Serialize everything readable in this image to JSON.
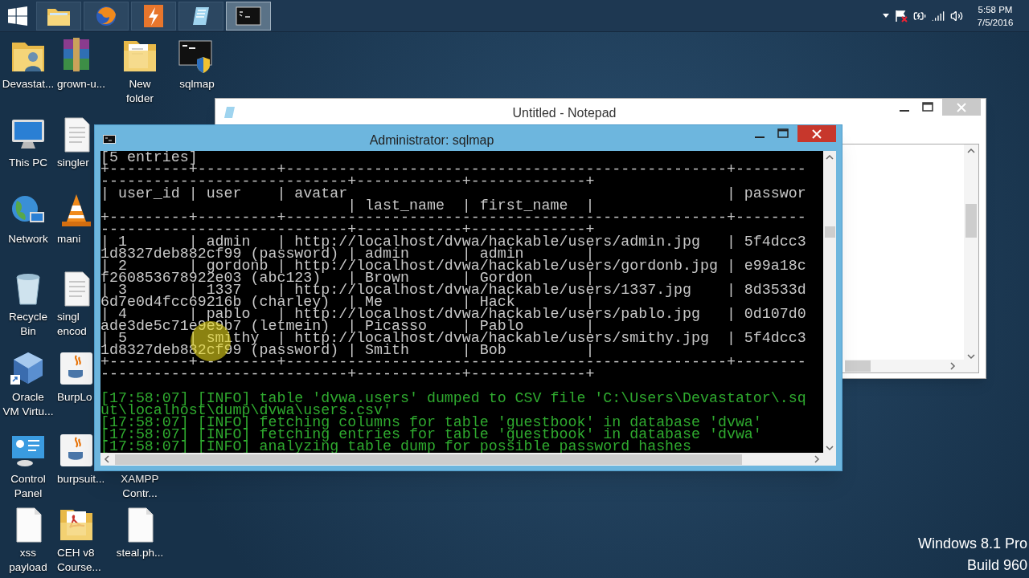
{
  "taskbar": {
    "apps": [
      {
        "kind": "folder",
        "selected": false
      },
      {
        "kind": "browser",
        "selected": false
      },
      {
        "kind": "bolt",
        "selected": false
      },
      {
        "kind": "notepad",
        "selected": false
      },
      {
        "kind": "console",
        "selected": true
      }
    ],
    "clock": {
      "time": "5:58 PM",
      "date": "7/5/2016"
    }
  },
  "desktop": {
    "columns": [
      [
        {
          "kind": "user-folder",
          "lines": [
            "Devastat..."
          ]
        },
        {
          "kind": "computer",
          "lines": [
            "This PC"
          ]
        },
        {
          "kind": "globe",
          "lines": [
            "Network"
          ]
        },
        {
          "kind": "recycle-bin",
          "lines": [
            "Recycle",
            "Bin"
          ]
        },
        {
          "kind": "virtual-box",
          "lines": [
            "Oracle",
            "VM Virtu..."
          ]
        },
        {
          "kind": "control-panel",
          "lines": [
            "Control",
            "Panel"
          ]
        },
        {
          "kind": "blank-file",
          "lines": [
            "xss",
            "payload"
          ]
        }
      ],
      [
        {
          "kind": "archive",
          "lines": [
            "grown-u..."
          ]
        },
        {
          "kind": "document",
          "lines": [
            "singler"
          ]
        },
        {
          "kind": "traffic-cone",
          "lines": [
            "mani"
          ]
        },
        {
          "kind": "document",
          "lines": [
            "singl",
            "encod"
          ]
        },
        {
          "kind": "java",
          "lines": [
            "BurpLo"
          ]
        },
        {
          "kind": "java",
          "lines": [
            "burpsuit..."
          ]
        },
        {
          "kind": "pdf-folder",
          "lines": [
            "CEH v8",
            "Course..."
          ]
        }
      ],
      [
        {
          "kind": "folder",
          "lines": [
            "New",
            "folder"
          ]
        },
        {
          "kind": "none",
          "lines": [
            "XAMPP",
            "Contr..."
          ]
        },
        {
          "kind": "blank-file",
          "lines": [
            "steal.ph..."
          ]
        }
      ],
      [
        {
          "kind": "console-shortcut",
          "lines": [
            "sqlmap"
          ]
        }
      ]
    ]
  },
  "notepad": {
    "title": "Untitled - Notepad"
  },
  "console": {
    "title": "Administrator: sqlmap",
    "lines": [
      {
        "kind": "table",
        "text": "[5 entries]"
      },
      {
        "kind": "table",
        "text": "+---------+---------+--------------------------------------------------+--------"
      },
      {
        "kind": "table",
        "text": "----------------------------+------------+-------------+"
      },
      {
        "kind": "table",
        "text": "| user_id | user    | avatar                                           | passwor"
      },
      {
        "kind": "table",
        "text": "                            | last_name  | first_name  |"
      },
      {
        "kind": "table",
        "text": "+---------+---------+--------------------------------------------------+--------"
      },
      {
        "kind": "table",
        "text": "----------------------------+------------+-------------+"
      },
      {
        "kind": "table",
        "text": "| 1       | admin   | http://localhost/dvwa/hackable/users/admin.jpg   | 5f4dcc3"
      },
      {
        "kind": "table",
        "text": "1d8327deb882cf99 (password) | admin      | admin       |"
      },
      {
        "kind": "table",
        "text": "| 2       | gordonb | http://localhost/dvwa/hackable/users/gordonb.jpg | e99a18c"
      },
      {
        "kind": "table",
        "text": "f260853678922e03 (abc123)   | Brown      | Gordon      |"
      },
      {
        "kind": "table",
        "text": "| 3       | 1337    | http://localhost/dvwa/hackable/users/1337.jpg    | 8d3533d"
      },
      {
        "kind": "table",
        "text": "6d7e0d4fcc69216b (charley)  | Me         | Hack        |"
      },
      {
        "kind": "table",
        "text": "| 4       | pablo   | http://localhost/dvwa/hackable/users/pablo.jpg   | 0d107d0"
      },
      {
        "kind": "table",
        "text": "ade3de5c71e9e9b7 (letmein)  | Picasso    | Pablo       |"
      },
      {
        "kind": "table",
        "text": "| 5       | smithy  | http://localhost/dvwa/hackable/users/smithy.jpg  | 5f4dcc3"
      },
      {
        "kind": "table",
        "text": "1d8327deb882cf99 (password) | Smith      | Bob         |"
      },
      {
        "kind": "table",
        "text": "+---------+---------+--------------------------------------------------+--------"
      },
      {
        "kind": "table",
        "text": "----------------------------+------------+-------------+"
      },
      {
        "kind": "info",
        "text": "[17:58:07] [INFO] table 'dvwa.users' dumped to CSV file 'C:\\Users\\Devastator\\.sq"
      },
      {
        "kind": "info",
        "text": "ut\\localhost\\dump\\dvwa\\users.csv'"
      },
      {
        "kind": "info",
        "text": "[17:58:07] [INFO] fetching columns for table 'guestbook' in database 'dvwa'"
      },
      {
        "kind": "info",
        "text": "[17:58:07] [INFO] fetching entries for table 'guestbook' in database 'dvwa'"
      },
      {
        "kind": "info",
        "text": "[17:58:07] [INFO] analyzing table dump for possible password hashes"
      }
    ]
  },
  "edition_text": [
    "Windows 8.1 Pro",
    "Build 960"
  ]
}
